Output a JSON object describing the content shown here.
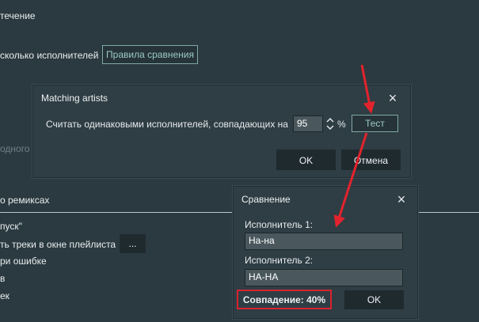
{
  "background": {
    "heading": "течение",
    "multi_artist_label": "сколько исполнителей",
    "rules_button": "Правила сравнения",
    "dim_text": "одного и",
    "remix_label": "о ремиксах",
    "quote_label": "пуск\"",
    "tracks_label": "ть треки в окне плейлиста",
    "ellipsis_button": "...",
    "error_label": "ри ошибке",
    "item_v": "в",
    "item_k": "ек"
  },
  "matching_dialog": {
    "title": "Matching artists",
    "prompt": "Считать одинаковыми исполнителей, совпадающих на",
    "percent_value": "95",
    "percent_sign": "%",
    "test_button": "Тест",
    "ok_button": "OK",
    "cancel_button": "Отмена"
  },
  "compare_dialog": {
    "title": "Сравнение",
    "artist1_label": "Исполнитель 1:",
    "artist1_value": "На-на",
    "artist2_label": "Исполнитель 2:",
    "artist2_value": "НА-НА",
    "match_result": "Совпадение: 40%",
    "ok_button": "OK"
  },
  "colors": {
    "background": "#2b3a40",
    "dialog": "#2f3d44",
    "accent": "#7fa9a5",
    "highlight": "#d9232e"
  }
}
